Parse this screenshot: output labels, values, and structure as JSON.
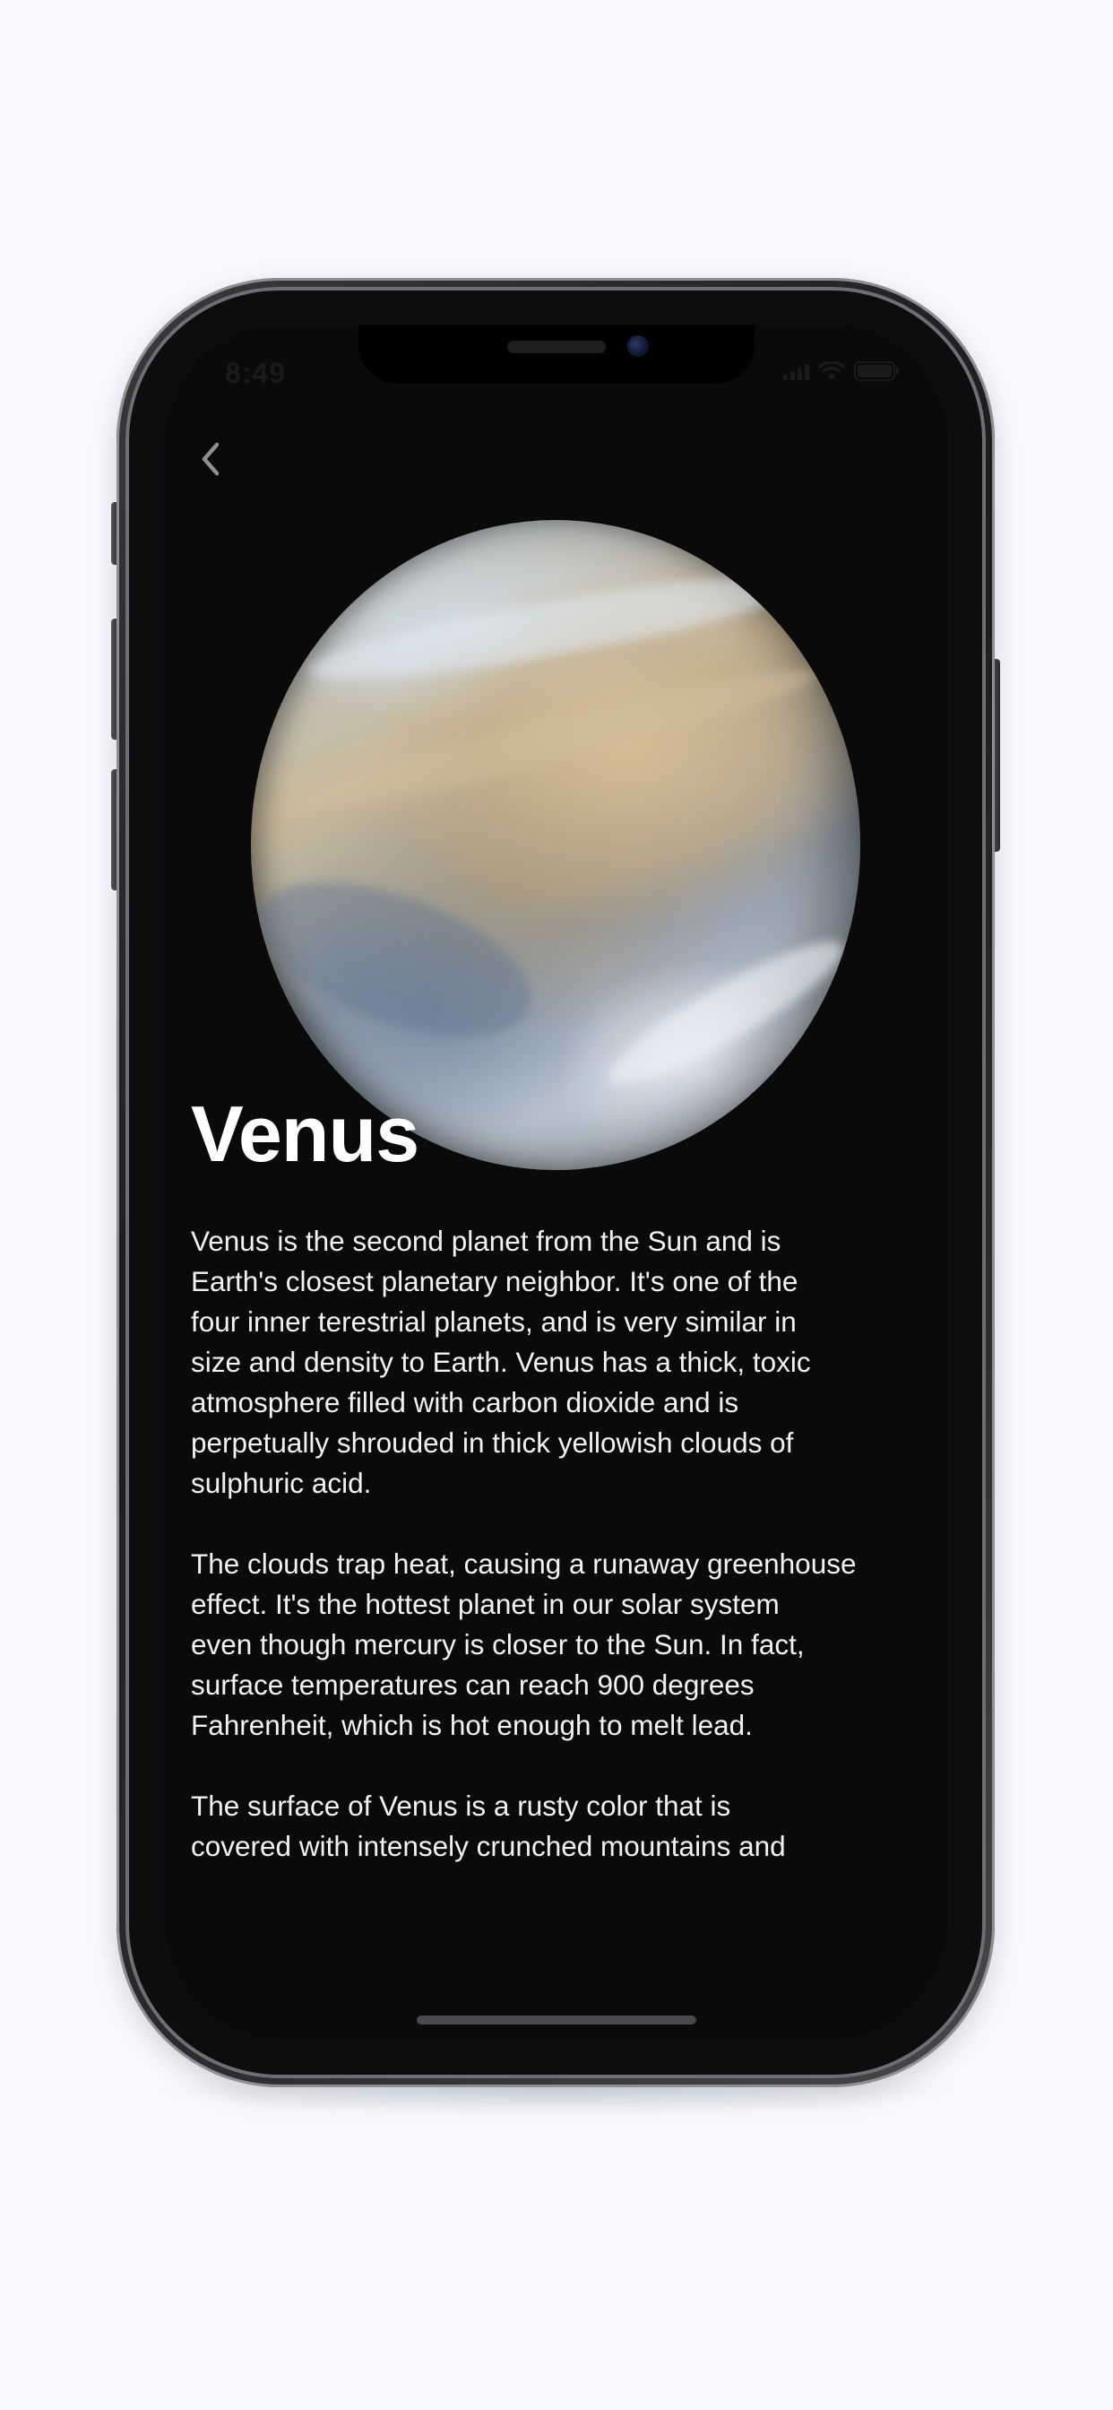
{
  "status_bar": {
    "time": "8:49"
  },
  "nav": {
    "back_icon": "chevron-left-icon"
  },
  "planet": {
    "name": "Venus",
    "image_icon": "venus-planet-image"
  },
  "description": {
    "paragraphs": [
      "Venus is the second planet from the Sun and is\nEarth's closest planetary neighbor. It's one of the\nfour inner terestrial planets, and is very similar in\nsize and density to Earth. Venus has a thick, toxic\natmosphere filled with carbon dioxide and is\nperpetually shrouded in thick yellowish clouds of\nsulphuric acid.",
      "The clouds trap heat, causing a runaway greenhouse\neffect. It's the hottest planet in our solar system\neven though mercury is closer to the Sun. In fact,\nsurface temperatures can reach 900 degrees\nFahrenheit, which is hot enough to melt lead.",
      " The surface of Venus is a rusty color that is\ncovered with intensely crunched mountains and"
    ]
  },
  "colors": {
    "page_background": "#f7f9fe",
    "screen_background": "#0a0a0b",
    "text": "#ffffff"
  }
}
